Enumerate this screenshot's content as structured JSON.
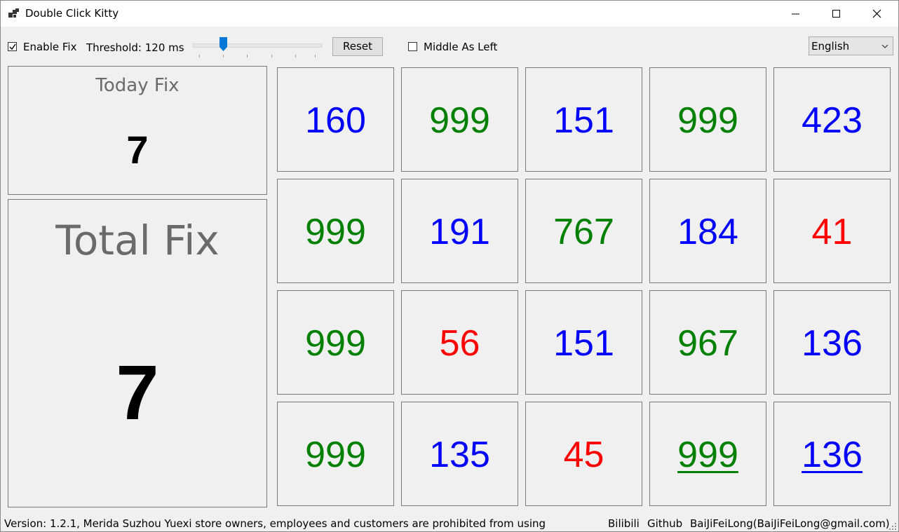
{
  "window": {
    "title": "Double Click Kitty",
    "controls": {
      "minimize": "minimize-icon",
      "maximize": "maximize-icon",
      "close": "close-icon"
    }
  },
  "toolbar": {
    "enable_fix": {
      "label": "Enable Fix",
      "checked": true
    },
    "threshold_label": "Threshold: 120 ms",
    "threshold_slider_value": 120,
    "reset_label": "Reset",
    "middle_as_left": {
      "label": "Middle As Left",
      "checked": false
    },
    "language": {
      "selected": "English"
    }
  },
  "stats": {
    "today": {
      "title": "Today Fix",
      "value": "7"
    },
    "total": {
      "title": "Total Fix",
      "value": "7"
    }
  },
  "colors": {
    "green": "#008000",
    "blue": "#0000ff",
    "red": "#ff0000"
  },
  "grid": [
    [
      {
        "value": "160",
        "color": "blue"
      },
      {
        "value": "999",
        "color": "green"
      },
      {
        "value": "151",
        "color": "blue"
      },
      {
        "value": "999",
        "color": "green"
      },
      {
        "value": "423",
        "color": "blue"
      }
    ],
    [
      {
        "value": "999",
        "color": "green"
      },
      {
        "value": "191",
        "color": "blue"
      },
      {
        "value": "767",
        "color": "green"
      },
      {
        "value": "184",
        "color": "blue"
      },
      {
        "value": "41",
        "color": "red"
      }
    ],
    [
      {
        "value": "999",
        "color": "green"
      },
      {
        "value": "56",
        "color": "red"
      },
      {
        "value": "151",
        "color": "blue"
      },
      {
        "value": "967",
        "color": "green"
      },
      {
        "value": "136",
        "color": "blue"
      }
    ],
    [
      {
        "value": "999",
        "color": "green"
      },
      {
        "value": "135",
        "color": "blue"
      },
      {
        "value": "45",
        "color": "red"
      },
      {
        "value": "999",
        "color": "green",
        "underlined": true
      },
      {
        "value": "136",
        "color": "blue",
        "underlined": true
      }
    ]
  ],
  "status": {
    "version_text": "Version: 1.2.1, Merida Suzhou Yuexi store owners, employees and customers are prohibited from using",
    "bilibili": "Bilibili",
    "github": "Github",
    "author": "BaiJiFeiLong(BaiJiFeiLong@gmail.com)"
  }
}
